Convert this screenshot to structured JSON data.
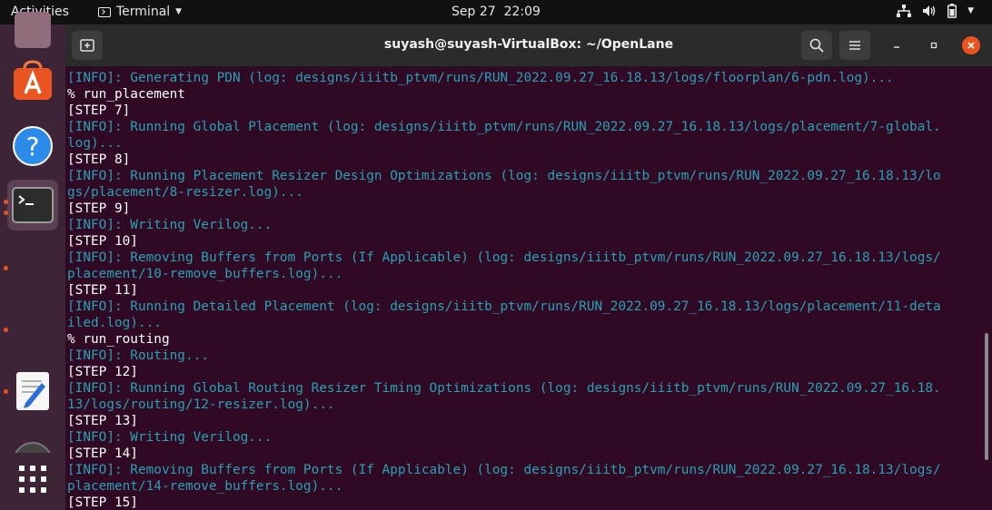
{
  "topbar": {
    "activities": "Activities",
    "app_name": "Terminal",
    "date": "Sep 27",
    "time": "22:09"
  },
  "dock": {
    "items": [
      "files",
      "ubuntu-software",
      "help",
      "terminal",
      "text-editor",
      "disc",
      "show-applications"
    ]
  },
  "window": {
    "title": "suyash@suyash-VirtualBox: ~/OpenLane"
  },
  "terminal": {
    "lines": [
      {
        "type": "info",
        "text": "[INFO]: Generating PDN (log: designs/iiitb_ptvm/runs/RUN_2022.09.27_16.18.13/logs/floorplan/6-pdn.log)..."
      },
      {
        "type": "cmd",
        "text": "% run_placement"
      },
      {
        "type": "step",
        "text": "[STEP 7]"
      },
      {
        "type": "info",
        "text": "[INFO]: Running Global Placement (log: designs/iiitb_ptvm/runs/RUN_2022.09.27_16.18.13/logs/placement/7-global."
      },
      {
        "type": "info",
        "text": "log)..."
      },
      {
        "type": "step",
        "text": "[STEP 8]"
      },
      {
        "type": "info",
        "text": "[INFO]: Running Placement Resizer Design Optimizations (log: designs/iiitb_ptvm/runs/RUN_2022.09.27_16.18.13/lo"
      },
      {
        "type": "info",
        "text": "gs/placement/8-resizer.log)..."
      },
      {
        "type": "step",
        "text": "[STEP 9]"
      },
      {
        "type": "info",
        "text": "[INFO]: Writing Verilog..."
      },
      {
        "type": "step",
        "text": "[STEP 10]"
      },
      {
        "type": "info",
        "text": "[INFO]: Removing Buffers from Ports (If Applicable) (log: designs/iiitb_ptvm/runs/RUN_2022.09.27_16.18.13/logs/"
      },
      {
        "type": "info",
        "text": "placement/10-remove_buffers.log)..."
      },
      {
        "type": "step",
        "text": "[STEP 11]"
      },
      {
        "type": "info",
        "text": "[INFO]: Running Detailed Placement (log: designs/iiitb_ptvm/runs/RUN_2022.09.27_16.18.13/logs/placement/11-deta"
      },
      {
        "type": "info",
        "text": "iled.log)..."
      },
      {
        "type": "cmd",
        "text": "% run_routing"
      },
      {
        "type": "info",
        "text": "[INFO]: Routing..."
      },
      {
        "type": "step",
        "text": "[STEP 12]"
      },
      {
        "type": "info",
        "text": "[INFO]: Running Global Routing Resizer Timing Optimizations (log: designs/iiitb_ptvm/runs/RUN_2022.09.27_16.18."
      },
      {
        "type": "info",
        "text": "13/logs/routing/12-resizer.log)..."
      },
      {
        "type": "step",
        "text": "[STEP 13]"
      },
      {
        "type": "info",
        "text": "[INFO]: Writing Verilog..."
      },
      {
        "type": "step",
        "text": "[STEP 14]"
      },
      {
        "type": "info",
        "text": "[INFO]: Removing Buffers from Ports (If Applicable) (log: designs/iiitb_ptvm/runs/RUN_2022.09.27_16.18.13/logs/"
      },
      {
        "type": "info",
        "text": "placement/14-remove_buffers.log)..."
      },
      {
        "type": "step",
        "text": "[STEP 15]"
      }
    ]
  },
  "colors": {
    "terminal_bg": "#300a24",
    "info_text": "#2aa1b3",
    "plain_text": "#ffffff",
    "accent": "#e95420"
  }
}
